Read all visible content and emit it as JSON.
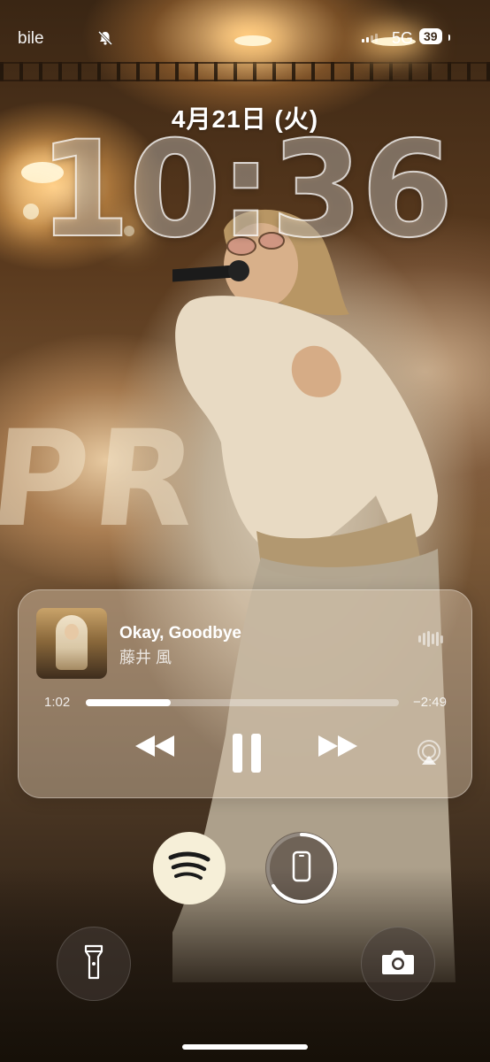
{
  "status_bar": {
    "carrier": "bile",
    "silent_icon": "bell-slash-icon",
    "signal_icon": "cellular-signal-icon",
    "network": "5G",
    "battery": "39"
  },
  "lock_screen": {
    "date": "4月21日 (火)",
    "time": "10:36"
  },
  "now_playing": {
    "title": "Okay, Goodbye",
    "artist": "藤井 風",
    "elapsed": "1:02",
    "remaining": "−2:49",
    "progress_fraction": 0.27,
    "controls": {
      "rewind_icon": "backward-icon",
      "pause_icon": "pause-icon",
      "forward_icon": "forward-icon",
      "airplay_icon": "airplay-icon",
      "waveform_icon": "waveform-icon"
    }
  },
  "shortcuts": {
    "spotify_icon": "spotify-icon",
    "device_icon": "iphone-icon",
    "flashlight_icon": "flashlight-icon",
    "camera_icon": "camera-icon"
  },
  "colors": {
    "spotify_button": "#f6efd8",
    "player_glass": "#e1cdb4"
  }
}
